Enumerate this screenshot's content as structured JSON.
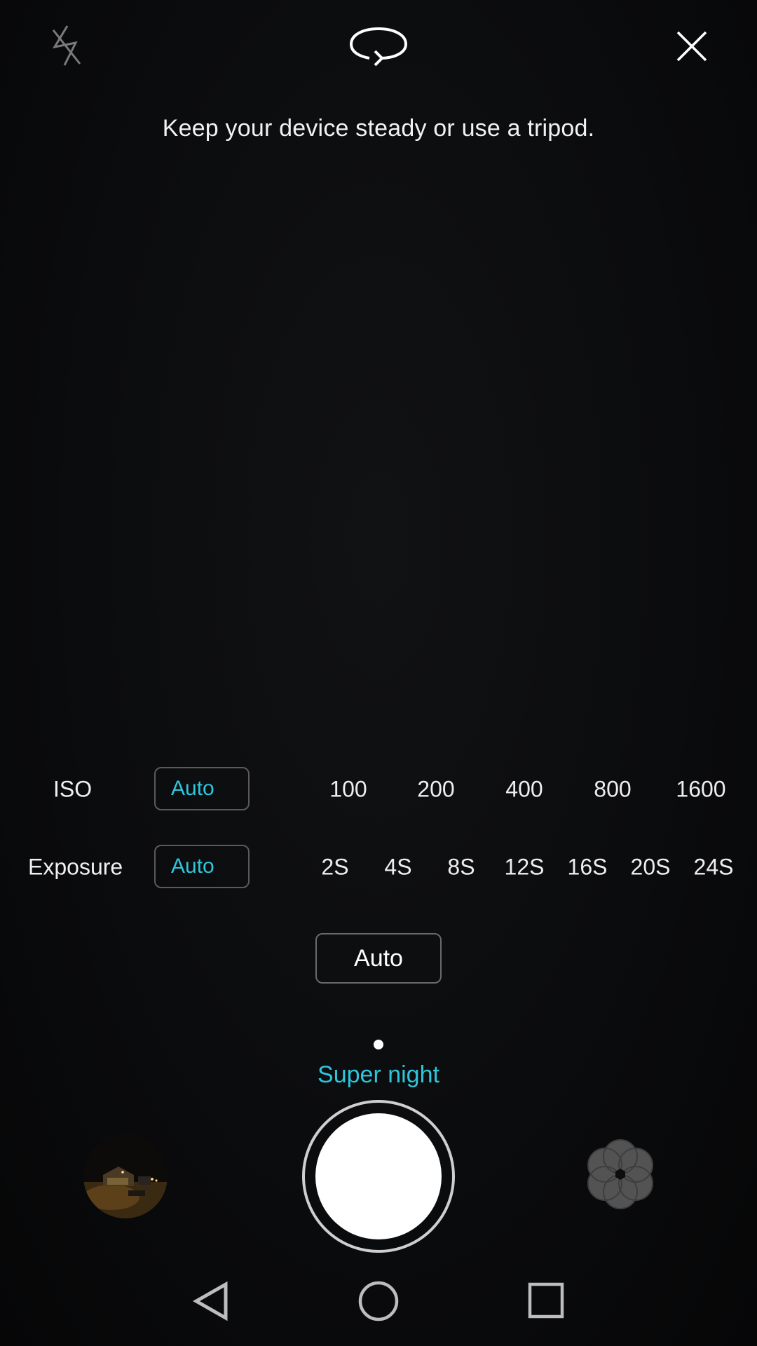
{
  "top_bar": {
    "flash_icon": "flash-off-icon",
    "switch_icon": "camera-switch-icon",
    "close_icon": "close-icon"
  },
  "hint_text": "Keep your device steady or use a tripod.",
  "iso": {
    "label": "ISO",
    "auto_label": "Auto",
    "options": [
      "100",
      "200",
      "400",
      "800",
      "1600"
    ]
  },
  "exposure": {
    "label": "Exposure",
    "auto_label": "Auto",
    "options": [
      "2S",
      "4S",
      "8S",
      "12S",
      "16S",
      "20S",
      "24S"
    ]
  },
  "auto_button_label": "Auto",
  "mode": {
    "label": "Super night"
  },
  "colors": {
    "accent": "#2ec6dc",
    "background": "#0b0c0e"
  },
  "bottom_bar": {
    "gallery_icon": "gallery-thumbnail",
    "shutter_icon": "shutter-button",
    "filter_icon": "filter-flower-icon"
  },
  "nav_bar": {
    "back_icon": "back-triangle-icon",
    "home_icon": "home-circle-icon",
    "recents_icon": "recents-square-icon"
  }
}
